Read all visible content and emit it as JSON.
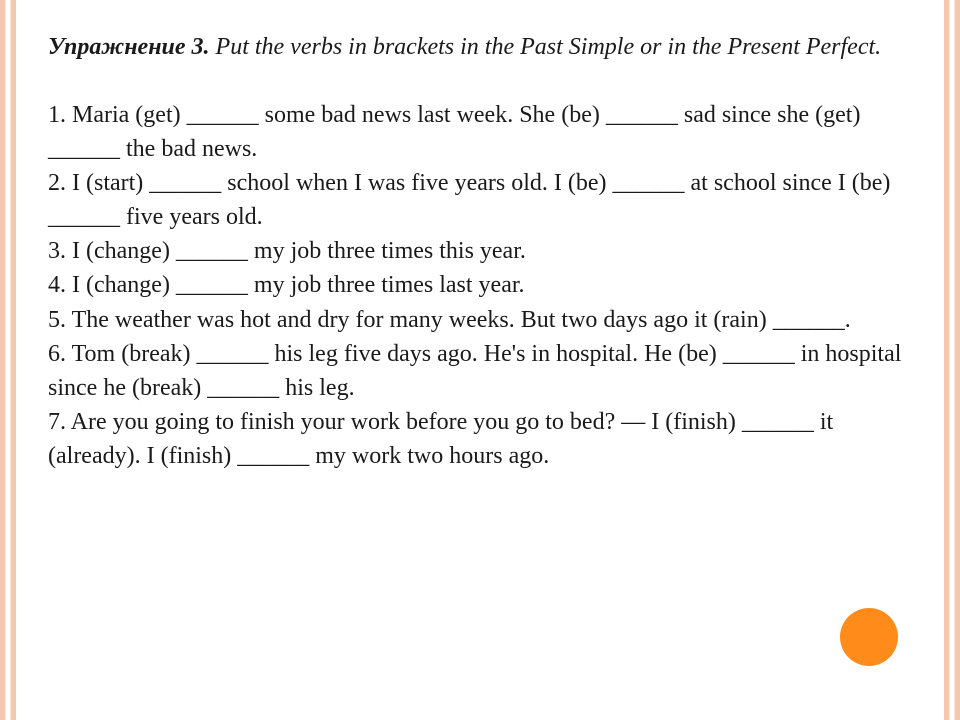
{
  "title": {
    "label": "Упражнение 3.",
    "instruction": " Put the verbs in brackets in the Past Simple or in the Present Perfect."
  },
  "items": {
    "i1": "1. Maria (get) ______ some bad news last week. She (be) ______ sad since she (get) ______  the bad news.",
    "i2": "2. I  (start) ______  school when I was five years old. I (be) ______  at school since I (be) ______  five years old.",
    "i3": "3. I  (change) ______ my job three times this year.",
    "i4": "4. I  (change) ______  my job three times last year.",
    "i5": "5.  The weather was hot and dry for many weeks. But two days ago it (rain) ______.",
    "i6": "6.  Tom (break) ______  his leg five days ago. He's in hospital. He (be) ______  in hospital since he (break) ______  his leg.",
    "i7": "7.  Are you going to finish your work before you go to bed? — I (finish) ______  it (already). I (finish) ______  my work two hours ago."
  }
}
